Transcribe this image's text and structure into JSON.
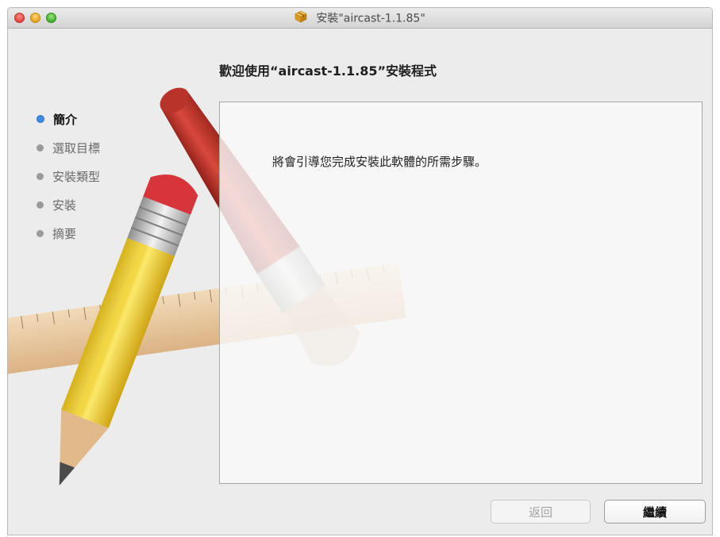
{
  "window": {
    "title": "安裝\"aircast-1.1.85\"",
    "icon": "package-icon"
  },
  "heading": "歡迎使用“aircast-1.1.85”安裝程式",
  "sidebar": {
    "steps": [
      {
        "label": "簡介",
        "active": true
      },
      {
        "label": "選取目標",
        "active": false
      },
      {
        "label": "安裝類型",
        "active": false
      },
      {
        "label": "安裝",
        "active": false
      },
      {
        "label": "摘要",
        "active": false
      }
    ]
  },
  "content": {
    "message": "將會引導您完成安裝此軟體的所需步驟。"
  },
  "buttons": {
    "back_label": "返回",
    "continue_label": "繼續"
  },
  "colors": {
    "active_step": "#3a8ce8",
    "close": "#e0443c",
    "minimize": "#e0a21c",
    "maximize": "#3fae2a"
  }
}
